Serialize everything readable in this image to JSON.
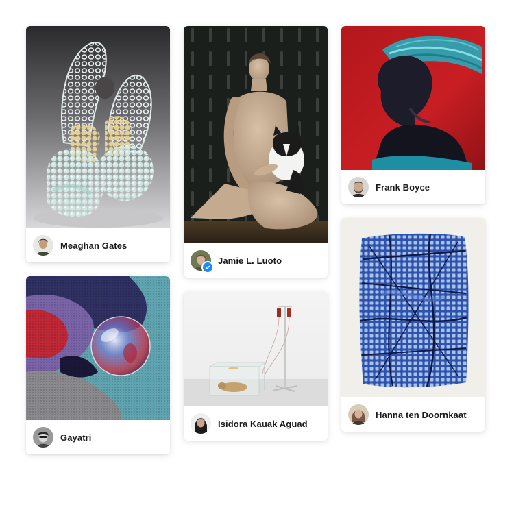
{
  "gallery": {
    "cards": [
      {
        "artist": "Meaghan Gates",
        "verified": false
      },
      {
        "artist": "Jamie L. Luoto",
        "verified": true
      },
      {
        "artist": "Frank Boyce",
        "verified": false
      },
      {
        "artist": "Gayatri",
        "verified": false
      },
      {
        "artist": "Isidora Kauak Aguad",
        "verified": false
      },
      {
        "artist": "Hanna ten Doornkaat",
        "verified": false
      }
    ]
  },
  "icons": {
    "verified": "verified-check-icon"
  },
  "colors": {
    "background": "#ffffff",
    "verified_badge": "#1d8cf8",
    "text": "#1a1a1a"
  }
}
